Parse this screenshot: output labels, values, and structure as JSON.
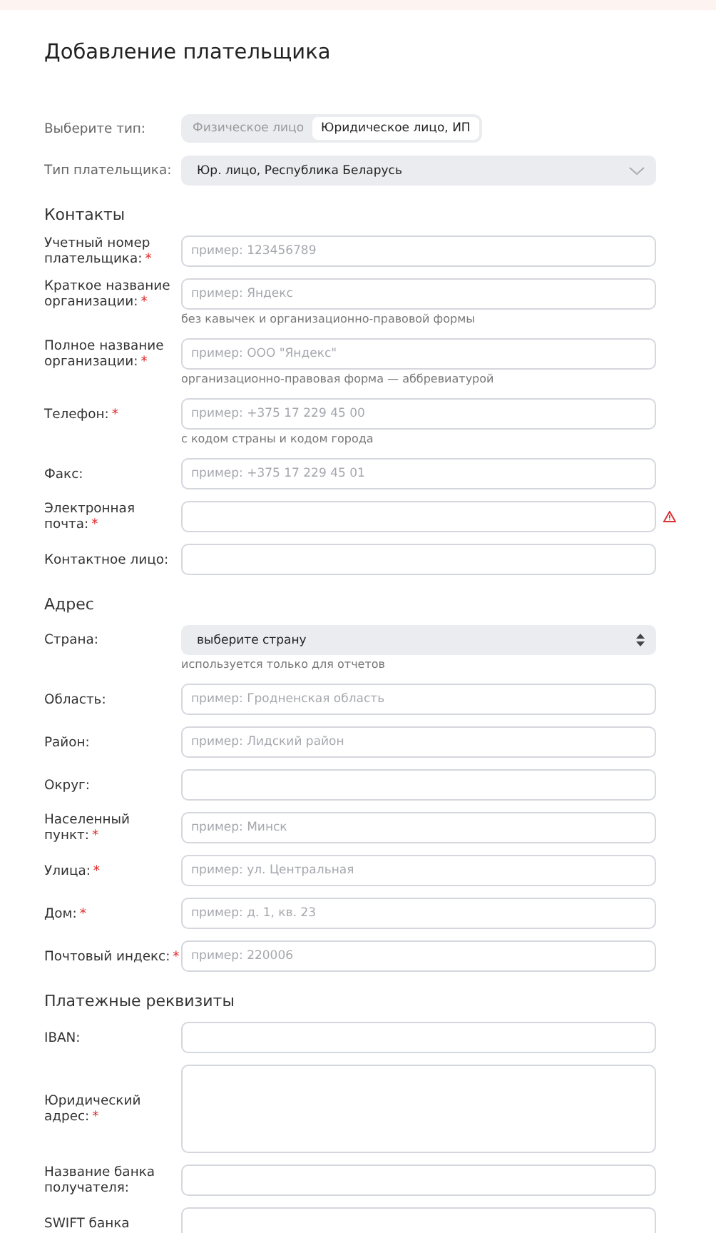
{
  "title": "Добавление плательщика",
  "type_switch": {
    "label": "Выберите тип:",
    "options": [
      {
        "label": "Физическое лицо",
        "selected": false
      },
      {
        "label": "Юридическое лицо, ИП",
        "selected": true
      }
    ]
  },
  "payer_type": {
    "label": "Тип плательщика:",
    "value": "Юр. лицо, Республика Беларусь"
  },
  "sections": [
    {
      "heading": "Контакты",
      "fields": [
        {
          "kind": "input",
          "label": "Учетный номер плательщика:",
          "mark": "*",
          "placeholder": "пример: 123456789"
        },
        {
          "kind": "input",
          "label": "Краткое название организации:",
          "mark": "*",
          "placeholder": "пример: Яндекс",
          "hint": "без кавычек и организационно-правовой формы"
        },
        {
          "kind": "input",
          "label": "Полное название организации:",
          "mark": "*",
          "placeholder": "пример: ООО \"Яндекс\"",
          "hint": "организационно-правовая форма — аббревиатурой"
        },
        {
          "kind": "input",
          "label": "Телефон:",
          "mark": "*",
          "placeholder": "пример: +375 17 229 45 00",
          "hint": "с кодом страны и кодом города"
        },
        {
          "kind": "input",
          "label": "Факс:",
          "placeholder": "пример: +375 17 229 45 01"
        },
        {
          "kind": "input",
          "label": "Электронная почта:",
          "mark": "*",
          "error": true
        },
        {
          "kind": "input",
          "label": "Контактное лицо:"
        }
      ]
    },
    {
      "heading": "Адрес",
      "fields": [
        {
          "kind": "select",
          "label": "Страна:",
          "value": "выберите страну",
          "hint": "используется только для отчетов"
        },
        {
          "kind": "input",
          "label": "Область:",
          "placeholder": "пример: Гродненская область"
        },
        {
          "kind": "input",
          "label": "Район:",
          "placeholder": "пример: Лидский район"
        },
        {
          "kind": "input",
          "label": "Округ:"
        },
        {
          "kind": "input",
          "label": "Населенный пункт:",
          "mark": "*",
          "placeholder": "пример: Минск"
        },
        {
          "kind": "input",
          "label": "Улица:",
          "mark": "*",
          "placeholder": "пример: ул. Центральная"
        },
        {
          "kind": "input",
          "label": "Дом:",
          "mark": "*",
          "placeholder": "пример: д. 1, кв. 23"
        },
        {
          "kind": "input",
          "label": "Почтовый индекс:",
          "mark": "*",
          "placeholder": "пример: 220006"
        }
      ]
    },
    {
      "heading": "Платежные реквизиты",
      "fields": [
        {
          "kind": "input",
          "label": "IBAN:"
        },
        {
          "kind": "textarea",
          "label": "Юридический адрес:",
          "mark": "*"
        },
        {
          "kind": "input",
          "label": "Название банка получателя:"
        },
        {
          "kind": "input",
          "label": "SWIFT банка"
        }
      ]
    }
  ]
}
